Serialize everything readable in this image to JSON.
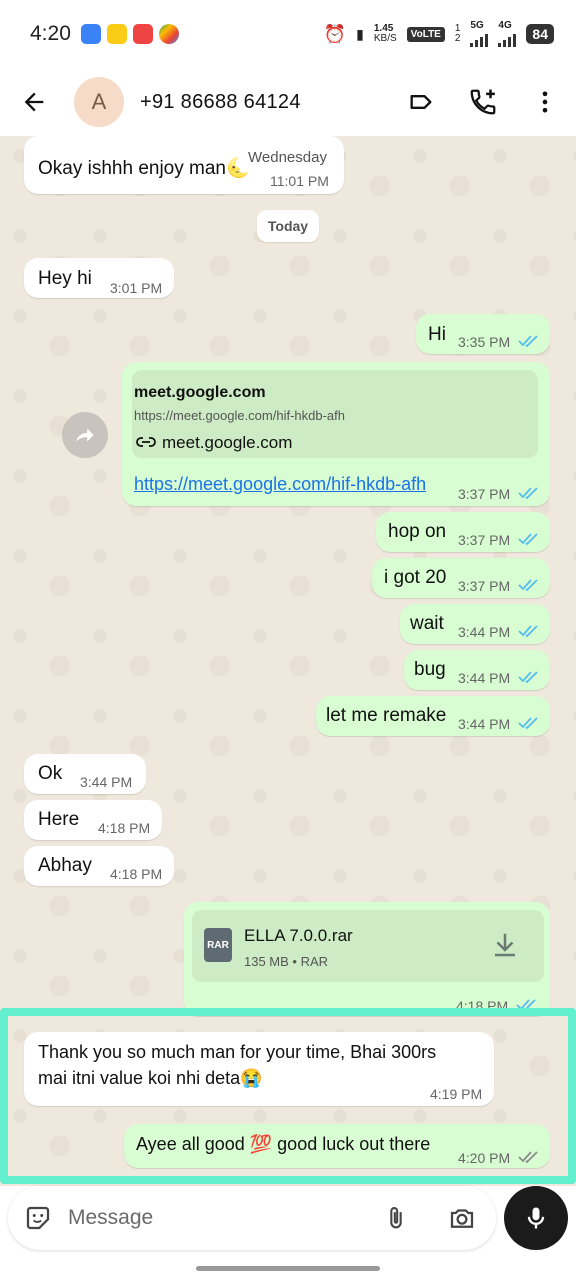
{
  "status_bar": {
    "time": "4:20",
    "net_speed_top": "1.45",
    "net_speed_bottom": "KB/S",
    "volte": "VoLTE",
    "sim1": "1",
    "sim2": "2",
    "net1": "5G",
    "net2": "4G",
    "battery": "84"
  },
  "header": {
    "avatar_letter": "A",
    "contact": "+91 86688 64124"
  },
  "day_label": "Today",
  "messages": {
    "m1": {
      "text": "Okay ishhh enjoy man🌜",
      "day": "Wednesday",
      "time": "11:01 PM"
    },
    "m2": {
      "text": "Hey hi",
      "time": "3:01 PM"
    },
    "m3": {
      "text": "Hi",
      "time": "3:35 PM"
    },
    "link": {
      "preview_title": "meet.google.com",
      "preview_url": "https://meet.google.com/hif-hkdb-afh",
      "preview_domain": "meet.google.com",
      "url": "https://meet.google.com/hif-hkdb-afh",
      "time": "3:37 PM"
    },
    "m5": {
      "text": "hop on",
      "time": "3:37 PM"
    },
    "m6": {
      "text": "i got 20",
      "time": "3:37 PM"
    },
    "m7": {
      "text": "wait",
      "time": "3:44 PM"
    },
    "m8": {
      "text": "bug",
      "time": "3:44 PM"
    },
    "m9": {
      "text": "let me remake",
      "time": "3:44 PM"
    },
    "m10": {
      "text": "Ok",
      "time": "3:44 PM"
    },
    "m11": {
      "text": "Here",
      "time": "4:18 PM"
    },
    "m12": {
      "text": "Abhay",
      "time": "4:18 PM"
    },
    "file": {
      "name": "ELLA 7.0.0.rar",
      "meta": "135 MB • RAR",
      "icon_label": "RAR",
      "time": "4:18 PM"
    },
    "m14": {
      "line1": "Thank you so much man for your time, Bhai 300rs",
      "line2": "mai itni value koi nhi deta😭",
      "time": "4:19 PM"
    },
    "m15": {
      "text": "Ayee all good 💯 good luck out there",
      "time": "4:20 PM"
    }
  },
  "input": {
    "placeholder": "Message"
  },
  "colors": {
    "outgoing": "#d9fdd3",
    "incoming": "#ffffff",
    "chat_bg": "#efe8dd",
    "highlight": "#62f0cf",
    "tick_read": "#53bdeb",
    "tick_sent": "#8a8a8a"
  }
}
